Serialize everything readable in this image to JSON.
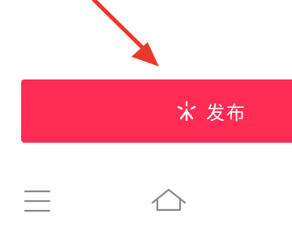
{
  "publish": {
    "label": "发布",
    "icon": "sparkle-icon",
    "background_color": "#fe2c55",
    "text_color": "#ffffff"
  },
  "annotation": {
    "icon": "red-arrow-icon",
    "color": "#e8392c"
  },
  "navbar": {
    "menu_icon": "hamburger-menu-icon",
    "home_icon": "home-icon",
    "icon_color": "#8a8a8a"
  }
}
